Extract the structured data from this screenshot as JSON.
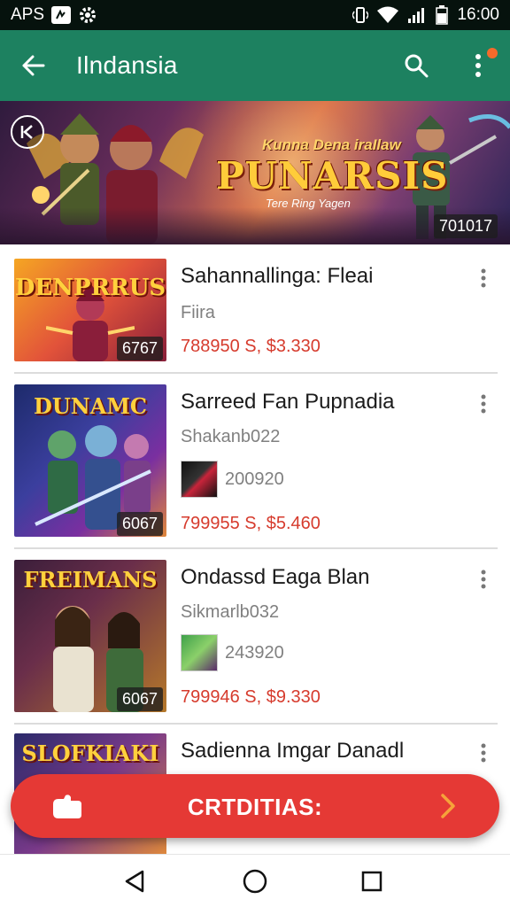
{
  "status_bar": {
    "carrier": "APS",
    "time": "16:00",
    "icons": [
      "notification-box-icon",
      "gear-icon",
      "vibrate-icon",
      "wifi-icon",
      "signal-icon",
      "battery-icon"
    ]
  },
  "app_bar": {
    "title": "Ilndansia",
    "icons": [
      "back-arrow-icon",
      "search-icon",
      "more-vert-icon"
    ],
    "accent": "#1d8160",
    "notification_dot_color": "#f46a2b"
  },
  "banner": {
    "subtitle": "Kunna Dena iraIlaw",
    "headline": "PUNARSIS",
    "tagline": "Tere Ring Yagen",
    "count": "701017",
    "icons": [
      "banner-back-icon"
    ]
  },
  "items": [
    {
      "thumb_title": "DENPRRUS",
      "thumb_count": "6767",
      "title": "Sahannallinga: Fleai",
      "subtitle": "Fiira",
      "meta_value": "",
      "price": "788950 S, $3.330"
    },
    {
      "thumb_title": "DUNAMC",
      "thumb_count": "6067",
      "title": "Sarreed Fan Pupnadia",
      "subtitle": "Shakanb022",
      "meta_value": "200920",
      "price": "799955 S, $5.460"
    },
    {
      "thumb_title": "FREIMANS",
      "thumb_count": "6067",
      "title": "Ondassd Eaga Blan",
      "subtitle": "Sikmarlb032",
      "meta_value": "243920",
      "price": "799946 S, $9.330"
    },
    {
      "thumb_title": "SLOFKIAKI",
      "thumb_count": "",
      "title": "Sadienna Imgar Danadl",
      "subtitle": "",
      "meta_value": "",
      "price": ""
    }
  ],
  "cta": {
    "label": "CRTDITIAS:",
    "color": "#e53935",
    "icons": [
      "hand-icon",
      "chevron-right-icon"
    ]
  },
  "nav_bar": {
    "icons": [
      "nav-back-icon",
      "nav-home-icon",
      "nav-recents-icon"
    ]
  }
}
